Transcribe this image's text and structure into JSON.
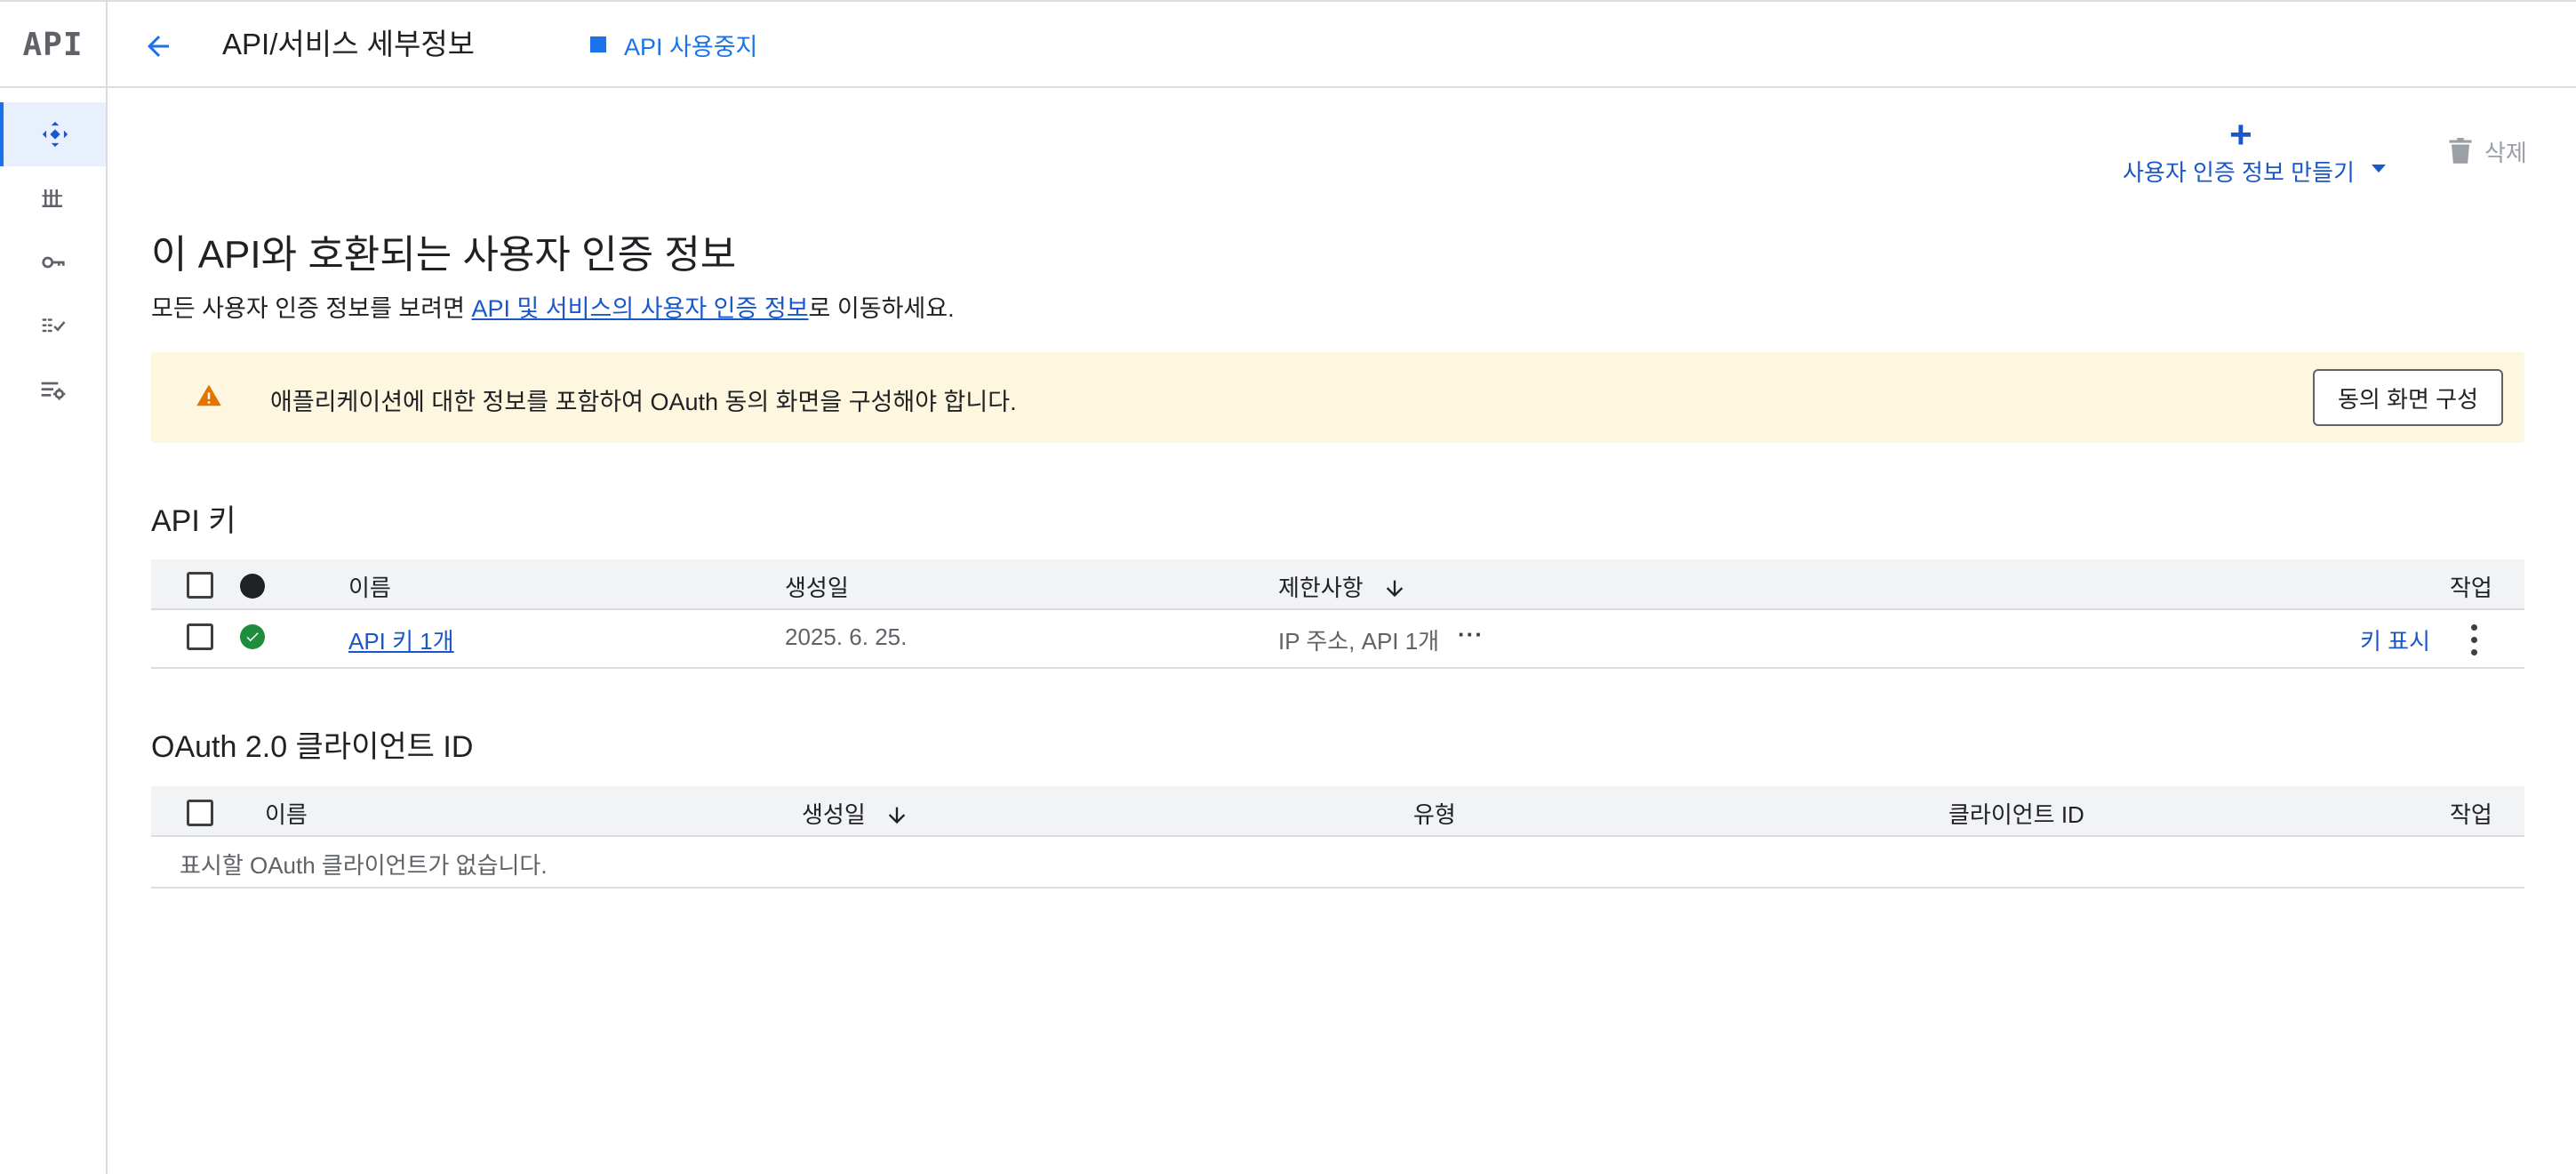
{
  "header": {
    "logo": "API",
    "title": "API/서비스 세부정보",
    "disable_label": "API 사용중지"
  },
  "sidebar": {
    "items": [
      {
        "name": "dashboard",
        "icon": "diamond-arrows-icon",
        "active": true
      },
      {
        "name": "library",
        "icon": "library-icon",
        "active": false
      },
      {
        "name": "credentials",
        "icon": "key-icon",
        "active": false
      },
      {
        "name": "consent",
        "icon": "checklist-icon",
        "active": false
      },
      {
        "name": "settings",
        "icon": "list-settings-icon",
        "active": false
      }
    ]
  },
  "toolbar": {
    "create_label": "사용자 인증 정보 만들기",
    "delete_label": "삭제"
  },
  "main": {
    "title": "이 API와 호환되는 사용자 인증 정보",
    "subtitle_prefix": "모든 사용자 인증 정보를 보려면 ",
    "subtitle_link": "API 및 서비스의 사용자 인증 정보",
    "subtitle_suffix": "로 이동하세요."
  },
  "warning": {
    "text": "애플리케이션에 대한 정보를 포함하여 OAuth 동의 화면을 구성해야 합니다.",
    "button": "동의 화면 구성",
    "color": "#fef7e0"
  },
  "api_keys": {
    "heading": "API 키",
    "columns": {
      "name": "이름",
      "created": "생성일",
      "restrictions": "제한사항",
      "actions": "작업"
    },
    "rows": [
      {
        "name": "API 키 1개",
        "created": "2025. 6. 25.",
        "restrictions": "IP 주소, API 1개",
        "more": "···",
        "show_key": "키 표시"
      }
    ]
  },
  "oauth": {
    "heading": "OAuth 2.0 클라이언트 ID",
    "columns": {
      "name": "이름",
      "created": "생성일",
      "type": "유형",
      "client_id": "클라이언트 ID",
      "actions": "작업"
    },
    "empty": "표시할 OAuth 클라이언트가 없습니다."
  },
  "colors": {
    "accent": "#1a73e8",
    "link": "#1a57c8",
    "status_ok": "#1e8e3e",
    "warning_icon": "#e37400"
  }
}
